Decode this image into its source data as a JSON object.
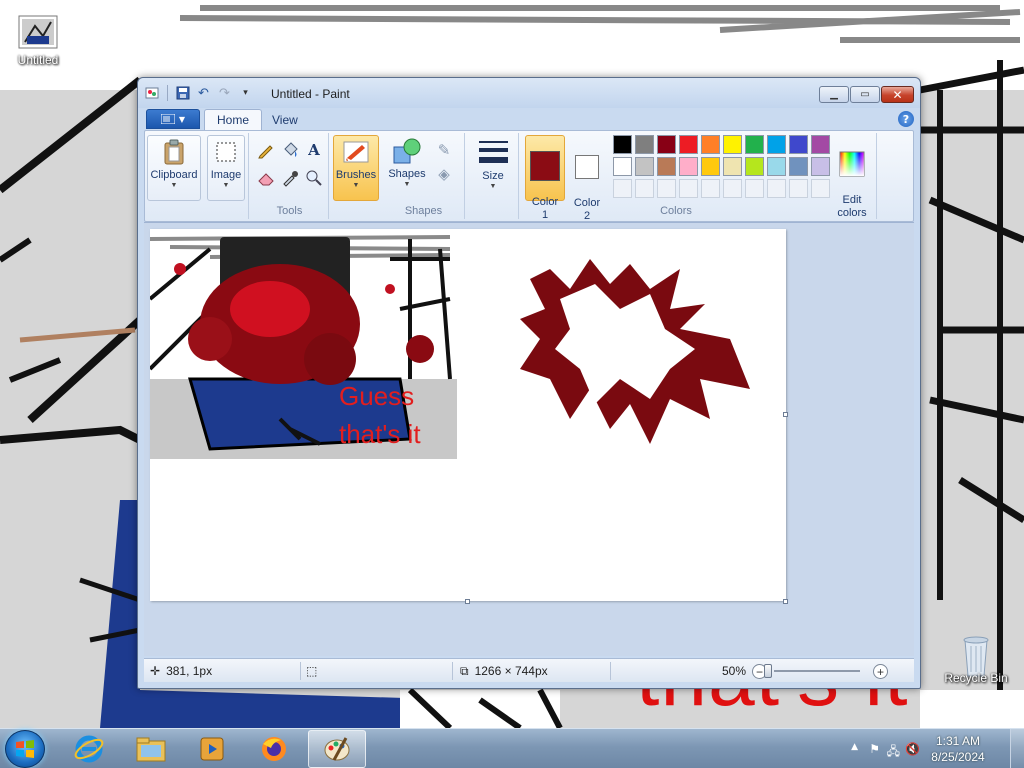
{
  "desktop": {
    "icons": [
      {
        "name": "desktop-icon-untitled",
        "label": "Untitled"
      },
      {
        "name": "desktop-icon-recycle-bin",
        "label": "Recycle Bin"
      }
    ],
    "wallpaper_text": "that's it"
  },
  "window": {
    "title": "Untitled - Paint",
    "tabs": [
      {
        "label": "Home"
      },
      {
        "label": "View"
      }
    ],
    "help_glyph": "?",
    "ribbon": {
      "clipboard": "Clipboard",
      "image": "Image",
      "tools_group": "Tools",
      "brushes": "Brushes",
      "shapes": "Shapes",
      "shapes_group": "Shapes",
      "size": "Size",
      "color1": "Color\n1",
      "color2": "Color\n2",
      "colors_group": "Colors",
      "edit_colors": "Edit\ncolors",
      "color1_value": "#8b0c14",
      "color2_value": "#ffffff",
      "palette_row1": [
        "#000000",
        "#7f7f7f",
        "#880015",
        "#ed1c24",
        "#ff7f27",
        "#fff200",
        "#22b14c",
        "#00a2e8",
        "#3f48cc",
        "#a349a4"
      ],
      "palette_row2": [
        "#ffffff",
        "#c3c3c3",
        "#b97a57",
        "#ffaec9",
        "#ffc90e",
        "#efe4b0",
        "#b5e61d",
        "#99d9ea",
        "#7092be",
        "#c8bfe7"
      ]
    },
    "canvas": {
      "text_line1": "Guess",
      "text_line2": "that's it"
    },
    "status": {
      "cursor_pos": "381, 1px",
      "image_size": "1266 × 744px",
      "zoom": "50%",
      "zoom_fraction": 0.5
    }
  },
  "taskbar": {
    "time": "1:31 AM",
    "date": "8/25/2024"
  }
}
